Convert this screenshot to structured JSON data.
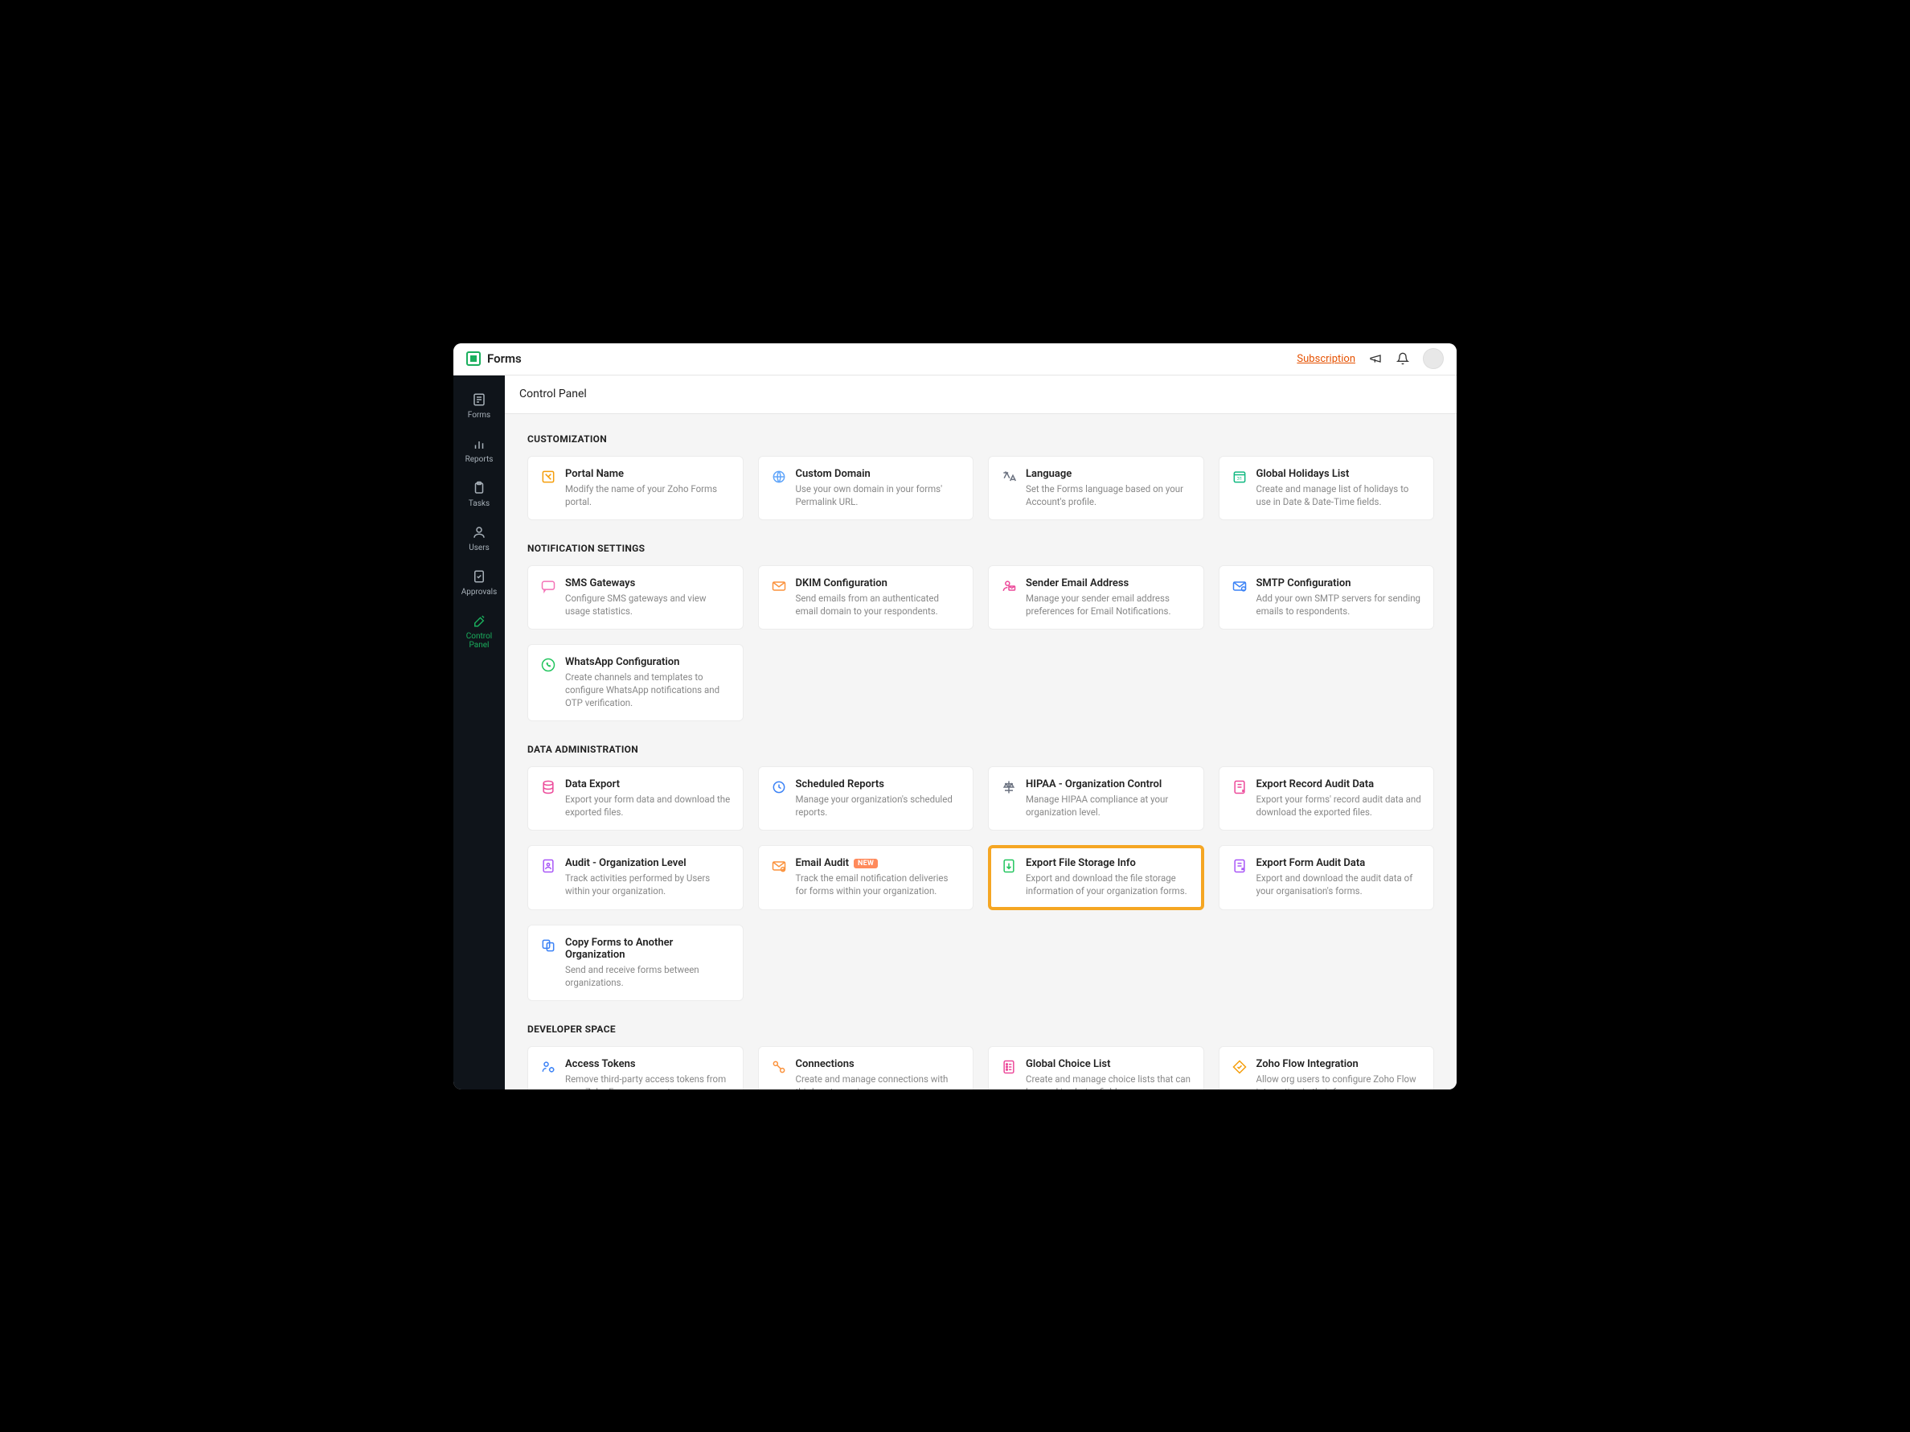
{
  "brand": {
    "name": "Forms"
  },
  "header": {
    "subscription": "Subscription"
  },
  "sidebar": {
    "items": [
      {
        "label": "Forms",
        "icon": "form"
      },
      {
        "label": "Reports",
        "icon": "stats"
      },
      {
        "label": "Tasks",
        "icon": "clipboard"
      },
      {
        "label": "Users",
        "icon": "user"
      },
      {
        "label": "Approvals",
        "icon": "check-doc"
      },
      {
        "label": "Control Panel",
        "icon": "tools"
      }
    ]
  },
  "page": {
    "title": "Control Panel"
  },
  "sections": [
    {
      "title": "CUSTOMIZATION",
      "cards": [
        {
          "id": "portal-name",
          "title": "Portal Name",
          "desc": "Modify the name of your Zoho Forms portal.",
          "iconColor": "#f59e0b"
        },
        {
          "id": "custom-domain",
          "title": "Custom Domain",
          "desc": "Use your own domain in your forms' Permalink URL.",
          "iconColor": "#60a5fa"
        },
        {
          "id": "language",
          "title": "Language",
          "desc": "Set the Forms language based on your Account's profile.",
          "iconColor": "#6b7280"
        },
        {
          "id": "global-holidays",
          "title": "Global Holidays List",
          "desc": "Create and manage list of holidays to use in Date & Date-Time fields.",
          "iconColor": "#10b981"
        }
      ]
    },
    {
      "title": "NOTIFICATION SETTINGS",
      "cards": [
        {
          "id": "sms-gateways",
          "title": "SMS Gateways",
          "desc": "Configure SMS gateways and view usage statistics.",
          "iconColor": "#f472b6"
        },
        {
          "id": "dkim-config",
          "title": "DKIM Configuration",
          "desc": "Send emails from an authenticated email domain to your respondents.",
          "iconColor": "#fb923c"
        },
        {
          "id": "sender-email",
          "title": "Sender Email Address",
          "desc": "Manage your sender email address preferences for Email Notifications.",
          "iconColor": "#ec4899"
        },
        {
          "id": "smtp-config",
          "title": "SMTP Configuration",
          "desc": "Add your own SMTP servers for sending emails to respondents.",
          "iconColor": "#3b82f6"
        },
        {
          "id": "whatsapp-config",
          "title": "WhatsApp Configuration",
          "desc": "Create channels and templates to configure WhatsApp notifications and OTP verification.",
          "iconColor": "#22c55e"
        }
      ]
    },
    {
      "title": "DATA ADMINISTRATION",
      "cards": [
        {
          "id": "data-export",
          "title": "Data Export",
          "desc": "Export your form data and download the exported files.",
          "iconColor": "#ec4899"
        },
        {
          "id": "scheduled-reports",
          "title": "Scheduled Reports",
          "desc": "Manage your organization's scheduled reports.",
          "iconColor": "#3b82f6"
        },
        {
          "id": "hipaa-control",
          "title": "HIPAA - Organization Control",
          "desc": "Manage HIPAA compliance at your organization level.",
          "iconColor": "#6b7280"
        },
        {
          "id": "export-record-audit",
          "title": "Export Record Audit Data",
          "desc": "Export your forms' record audit data and download the exported files.",
          "iconColor": "#ec4899"
        },
        {
          "id": "audit-org",
          "title": "Audit - Organization Level",
          "desc": "Track activities performed by Users within your organization.",
          "iconColor": "#a855f7"
        },
        {
          "id": "email-audit",
          "title": "Email Audit",
          "desc": "Track the email notification deliveries for forms within your organization.",
          "iconColor": "#fb923c",
          "badge": "NEW"
        },
        {
          "id": "export-file-storage",
          "title": "Export File Storage Info",
          "desc": "Export and download the file storage information of your organization forms.",
          "iconColor": "#22c55e",
          "highlighted": true
        },
        {
          "id": "export-form-audit",
          "title": "Export Form Audit Data",
          "desc": "Export and download the audit data of your organisation's forms.",
          "iconColor": "#a855f7"
        },
        {
          "id": "copy-forms",
          "title": "Copy Forms to Another Organization",
          "desc": "Send and receive forms between organizations.",
          "iconColor": "#3b82f6"
        }
      ]
    },
    {
      "title": "DEVELOPER SPACE",
      "cards": [
        {
          "id": "access-tokens",
          "title": "Access Tokens",
          "desc": "Remove third-party access tokens from your Zoho Forms account.",
          "iconColor": "#3b82f6"
        },
        {
          "id": "connections",
          "title": "Connections",
          "desc": "Create and manage connections with third-party services.",
          "iconColor": "#fb923c"
        },
        {
          "id": "global-choice-list",
          "title": "Global Choice List",
          "desc": "Create and manage choice lists that can be used in choice fields.",
          "iconColor": "#ec4899"
        },
        {
          "id": "zoho-flow",
          "title": "Zoho Flow Integration",
          "desc": "Allow org users to configure Zoho Flow integration in their forms.",
          "iconColor": "#f59e0b"
        }
      ]
    }
  ]
}
